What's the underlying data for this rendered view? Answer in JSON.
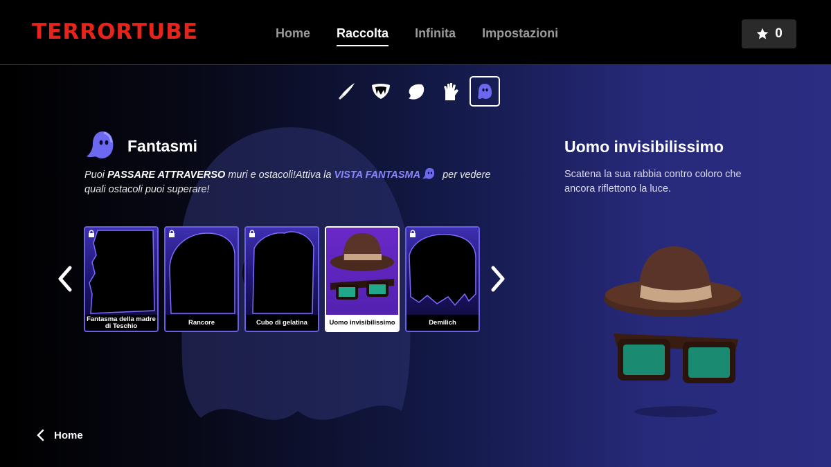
{
  "app": {
    "logo": "TERRORTUBE"
  },
  "nav": {
    "items": [
      {
        "label": "Home",
        "active": false
      },
      {
        "label": "Raccolta",
        "active": true
      },
      {
        "label": "Infinita",
        "active": false
      },
      {
        "label": "Impostazioni",
        "active": false
      }
    ]
  },
  "score": {
    "icon": "star-icon",
    "value": "0"
  },
  "categories": [
    {
      "icon": "knife-icon",
      "active": false
    },
    {
      "icon": "fangs-icon",
      "active": false
    },
    {
      "icon": "blob-icon",
      "active": false
    },
    {
      "icon": "zombie-hand-icon",
      "active": false
    },
    {
      "icon": "ghost-icon",
      "active": true
    }
  ],
  "section": {
    "title": "Fantasmi",
    "desc_prefix": "Puoi ",
    "desc_bold": "PASSARE ATTRAVERSO",
    "desc_mid": " muri e ostacoli!Attiva la ",
    "desc_vista": "VISTA FANTASMA",
    "desc_suffix": " per vedere quali ostacoli puoi superare!"
  },
  "cards": [
    {
      "label": "Fantasma della madre di Teschio",
      "locked": true,
      "selected": false
    },
    {
      "label": "Rancore",
      "locked": true,
      "selected": false
    },
    {
      "label": "Cubo di gelatina",
      "locked": true,
      "selected": false
    },
    {
      "label": "Uomo invisibilissimo",
      "locked": false,
      "selected": true
    },
    {
      "label": "Demilich",
      "locked": true,
      "selected": false
    }
  ],
  "selected_item": {
    "title": "Uomo invisibilissimo",
    "description": "Scatena la sua rabbia contro coloro che ancora riflettono la luce."
  },
  "footer": {
    "back_label": "Home"
  },
  "colors": {
    "logo": "#e5241c",
    "accent": "#6a5ee8",
    "vista": "#8b86ff"
  }
}
